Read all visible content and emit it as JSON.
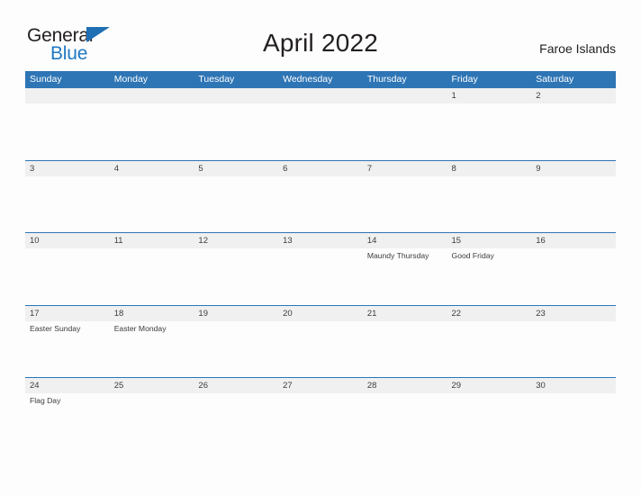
{
  "brand": {
    "name_part1": "General",
    "name_part2": "Blue",
    "flag_icon": "blue-flag-triangle",
    "accent_color": "#2179c4"
  },
  "header": {
    "title": "April 2022",
    "region": "Faroe Islands"
  },
  "theme": {
    "header_blue": "#2e75b5",
    "date_band_gray": "#f0f0f0",
    "page_background": "#fdfdfd",
    "text_color": "#3c3c3c"
  },
  "calendar": {
    "month": "April",
    "year": "2022",
    "weekday_headers": [
      "Sunday",
      "Monday",
      "Tuesday",
      "Wednesday",
      "Thursday",
      "Friday",
      "Saturday"
    ],
    "weeks": [
      {
        "days": [
          {
            "date": "",
            "event": ""
          },
          {
            "date": "",
            "event": ""
          },
          {
            "date": "",
            "event": ""
          },
          {
            "date": "",
            "event": ""
          },
          {
            "date": "",
            "event": ""
          },
          {
            "date": "1",
            "event": ""
          },
          {
            "date": "2",
            "event": ""
          }
        ]
      },
      {
        "days": [
          {
            "date": "3",
            "event": ""
          },
          {
            "date": "4",
            "event": ""
          },
          {
            "date": "5",
            "event": ""
          },
          {
            "date": "6",
            "event": ""
          },
          {
            "date": "7",
            "event": ""
          },
          {
            "date": "8",
            "event": ""
          },
          {
            "date": "9",
            "event": ""
          }
        ]
      },
      {
        "days": [
          {
            "date": "10",
            "event": ""
          },
          {
            "date": "11",
            "event": ""
          },
          {
            "date": "12",
            "event": ""
          },
          {
            "date": "13",
            "event": ""
          },
          {
            "date": "14",
            "event": "Maundy Thursday"
          },
          {
            "date": "15",
            "event": "Good Friday"
          },
          {
            "date": "16",
            "event": ""
          }
        ]
      },
      {
        "days": [
          {
            "date": "17",
            "event": "Easter Sunday"
          },
          {
            "date": "18",
            "event": "Easter Monday"
          },
          {
            "date": "19",
            "event": ""
          },
          {
            "date": "20",
            "event": ""
          },
          {
            "date": "21",
            "event": ""
          },
          {
            "date": "22",
            "event": ""
          },
          {
            "date": "23",
            "event": ""
          }
        ]
      },
      {
        "days": [
          {
            "date": "24",
            "event": "Flag Day"
          },
          {
            "date": "25",
            "event": ""
          },
          {
            "date": "26",
            "event": ""
          },
          {
            "date": "27",
            "event": ""
          },
          {
            "date": "28",
            "event": ""
          },
          {
            "date": "29",
            "event": ""
          },
          {
            "date": "30",
            "event": ""
          }
        ]
      }
    ]
  }
}
